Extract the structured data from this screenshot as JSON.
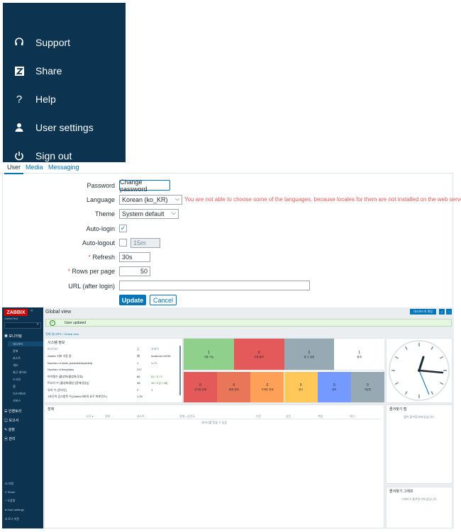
{
  "menu": {
    "items": [
      {
        "label": "Support",
        "icon": "headset-icon"
      },
      {
        "label": "Share",
        "icon": "zabbix-share-icon"
      },
      {
        "label": "Help",
        "icon": "question-icon"
      },
      {
        "label": "User settings",
        "icon": "user-icon"
      },
      {
        "label": "Sign out",
        "icon": "power-icon"
      }
    ]
  },
  "tabs": {
    "user": "User",
    "media": "Media",
    "messaging": "Messaging"
  },
  "form": {
    "password_label": "Password",
    "change_password_button": "Change password",
    "language_label": "Language",
    "language_value": "Korean (ko_KR)",
    "language_warning": "You are not able to choose some of the languages, because locales for them are not installed on the web server.",
    "theme_label": "Theme",
    "theme_value": "System default",
    "autologin_label": "Auto-login",
    "autologin_checked": true,
    "autologout_label": "Auto-logout",
    "autologout_value": "15m",
    "refresh_label": "Refresh",
    "refresh_value": "30s",
    "rows_label": "Rows per page",
    "rows_value": "50",
    "url_label": "URL (after login)",
    "url_value": "",
    "update_button": "Update",
    "cancel_button": "Cancel",
    "required_mark": "*"
  },
  "zabbix": {
    "logo": "ZABBIX",
    "logo_sub": "ZabbixTest",
    "collapse": "«",
    "sidebar": {
      "monitoring": "모니터링",
      "monitoring_items": [
        "대시보드",
        "장애",
        "호스트",
        "개요",
        "최근 데이터",
        "스크린",
        "맵",
        "디스커버리",
        "서비스"
      ],
      "inventory": "인벤토리",
      "reports": "보고서",
      "configuration": "설정",
      "administration": "관리",
      "bottom": [
        "지원",
        "Share",
        "도움말",
        "User settings",
        "로그 아웃"
      ]
    },
    "title": "Global view",
    "header_button": "대시보드의 편집",
    "alert": "User updated",
    "breadcrumb": "전체 대시보드 / Global view",
    "system_info": {
      "title": "시스템 정보",
      "headers": [
        "파라미터",
        "값",
        "자세히"
      ],
      "rows": [
        [
          "Zabbix 서버 가동 중",
          "예",
          "localhost:10051"
        ],
        [
          "Number of hosts (enabled/disabled)",
          "1",
          "1 / 0"
        ],
        [
          "Number of templates",
          "217",
          ""
        ],
        [
          "아이템수 (활성화/활성화/무효)",
          "86",
          "81 / 0 / 5"
        ],
        [
          "트리거 수 (활성화/활성 [장애/정상])",
          "48",
          "48 / 0 [0 / 48]"
        ],
        [
          "유저 수 (온라인)",
          "2",
          "1"
        ],
        [
          "1초간의 감시항목 수(Zabbix서버의 요구 퍼포먼스)",
          "1.29",
          ""
        ]
      ]
    },
    "host_tiles": [
      {
        "count": "1",
        "label": "이용 가능",
        "color": "#8fd18c"
      },
      {
        "count": "0",
        "label": "이용 불가",
        "color": "#e45959"
      },
      {
        "count": "0",
        "label": "알 수 없음",
        "color": "#97aab3"
      },
      {
        "count": "1",
        "label": "합계",
        "color": "#ffffff"
      }
    ],
    "severity_tiles": [
      {
        "count": "0",
        "label": "심각한 장애",
        "color": "#e45959"
      },
      {
        "count": "0",
        "label": "중증 장애",
        "color": "#e97659"
      },
      {
        "count": "0",
        "label": "가벼운 장애",
        "color": "#ffa059"
      },
      {
        "count": "0",
        "label": "경고",
        "color": "#ffc859"
      },
      {
        "count": "0",
        "label": "정보",
        "color": "#7499ff"
      },
      {
        "count": "0",
        "label": "미분류",
        "color": "#97aab3"
      }
    ],
    "problems": {
      "title": "장애",
      "headers": [
        "시각 ▾",
        "정보",
        "호스트",
        "장애 • 심각도",
        "기간",
        "승인",
        "액션",
        "태그"
      ],
      "empty": "데이터를 찾을 수 없음"
    },
    "fav_maps": {
      "title": "즐겨찾기 맵",
      "empty": "맵이 즐겨찾기에 없습니다."
    },
    "fav_graphs": {
      "title": "즐겨찾기 그래프",
      "empty": "그래프가 즐겨찾기에 없습니다."
    }
  }
}
